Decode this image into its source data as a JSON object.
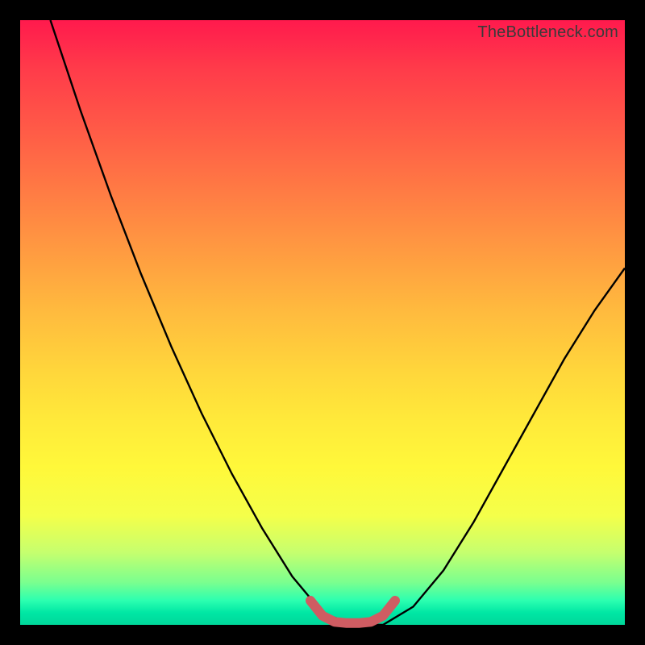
{
  "attribution": "TheBottleneck.com",
  "chart_data": {
    "type": "line",
    "title": "",
    "xlabel": "",
    "ylabel": "",
    "xlim": [
      0,
      100
    ],
    "ylim": [
      0,
      100
    ],
    "series": [
      {
        "name": "black-curve",
        "x": [
          5,
          10,
          15,
          20,
          25,
          30,
          35,
          40,
          45,
          50,
          55,
          60,
          65,
          70,
          75,
          80,
          85,
          90,
          95,
          100
        ],
        "values": [
          100,
          85,
          71,
          58,
          46,
          35,
          25,
          16,
          8,
          2,
          0,
          0,
          3,
          9,
          17,
          26,
          35,
          44,
          52,
          59
        ]
      },
      {
        "name": "pink-marker",
        "x": [
          48,
          50,
          52,
          54,
          56,
          58,
          60,
          62
        ],
        "values": [
          4,
          1.5,
          0.5,
          0.3,
          0.3,
          0.5,
          1.5,
          4
        ]
      }
    ]
  },
  "colors": {
    "black": "#000000",
    "pink": "#cf5c62"
  }
}
